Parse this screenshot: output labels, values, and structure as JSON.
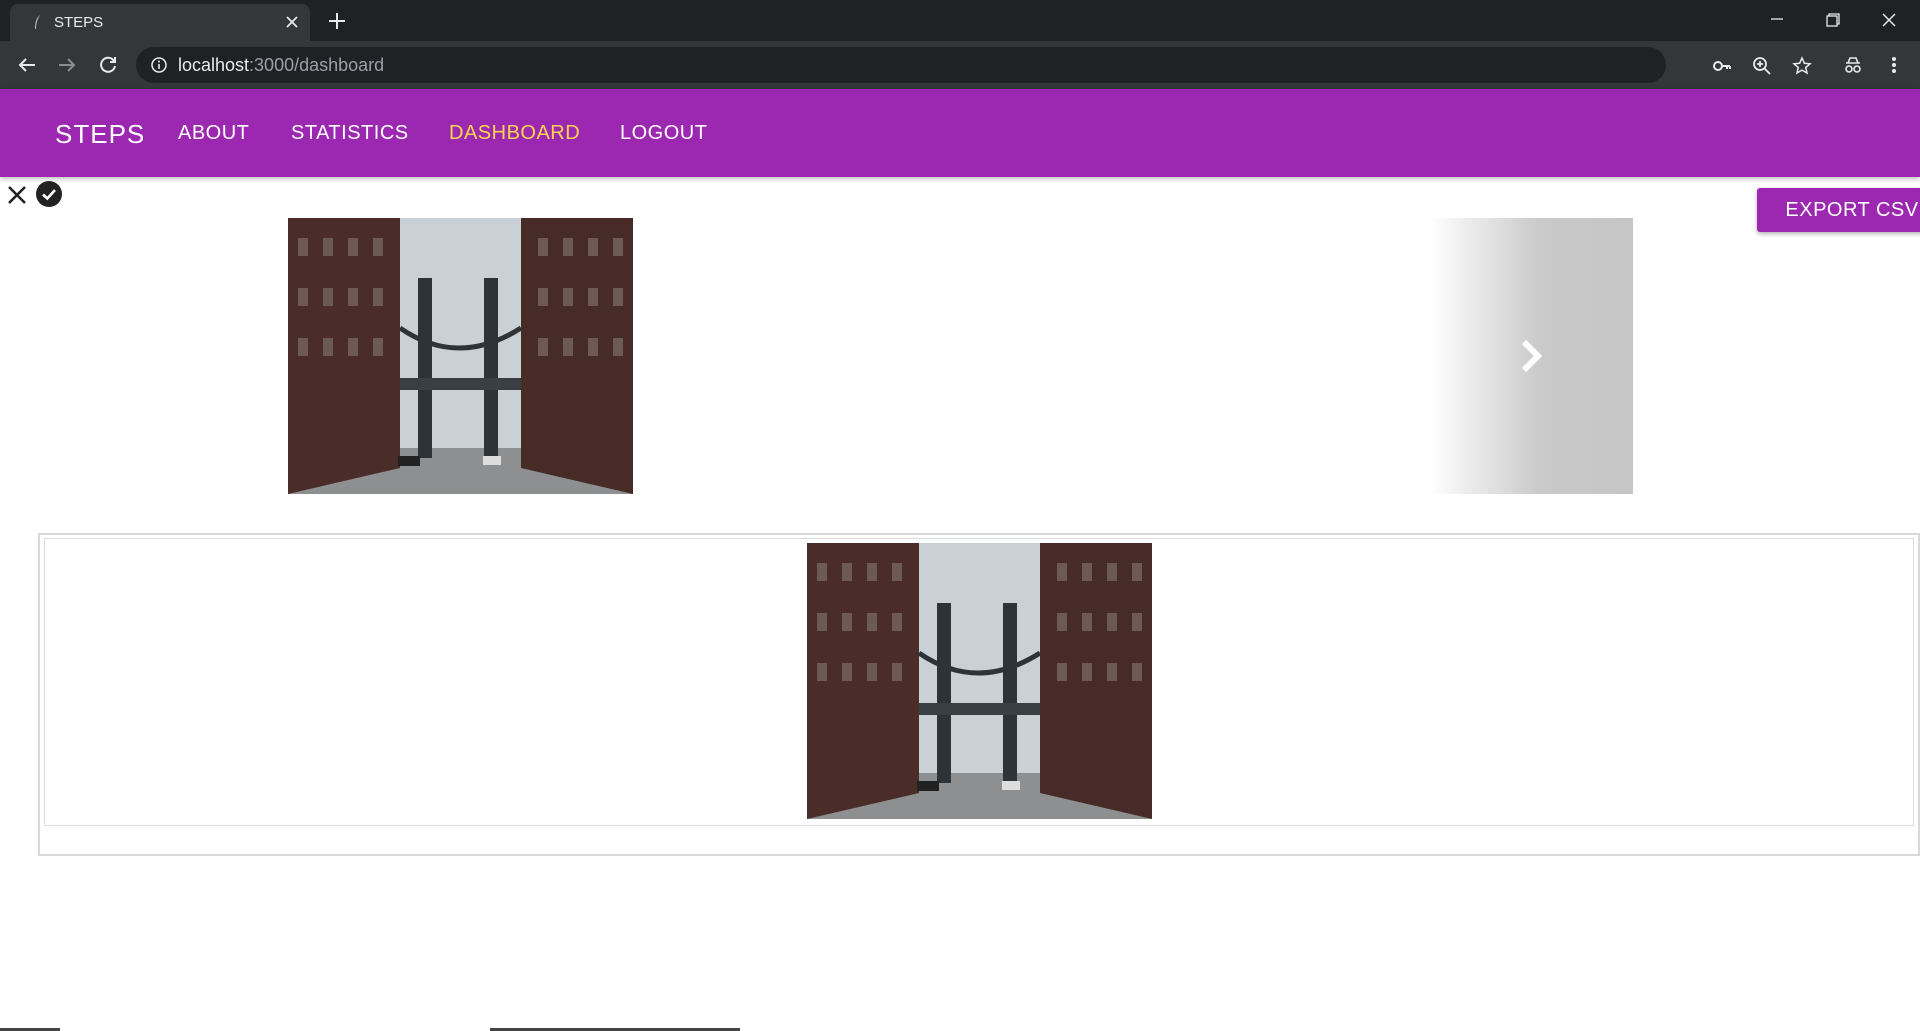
{
  "browser": {
    "tab_title": "STEPS",
    "url_host": "localhost",
    "url_path": ":3000/dashboard"
  },
  "navbar": {
    "brand": "STEPS",
    "links": [
      "ABOUT",
      "STATISTICS",
      "DASHBOARD",
      "LOGOUT"
    ],
    "active_link": "DASHBOARD",
    "background_color": "#9c27b0",
    "active_color": "#ffd54f"
  },
  "toolbar": {
    "export_label": "EXPORT CSV"
  },
  "icons": {
    "close": "close-icon",
    "check": "check-circle-icon",
    "next": "chevron-right-icon"
  }
}
